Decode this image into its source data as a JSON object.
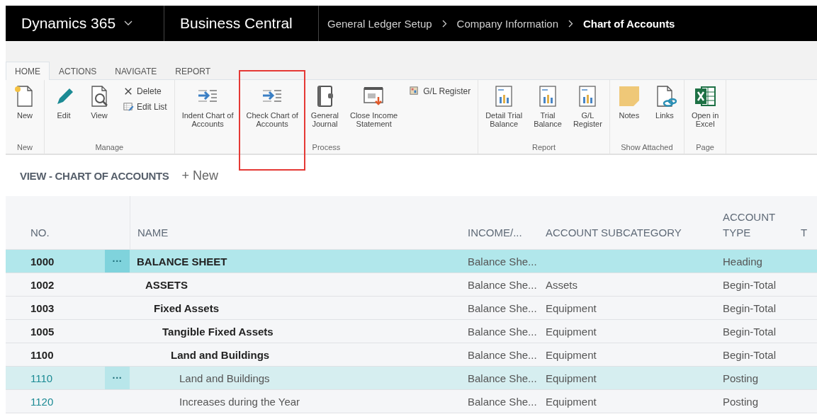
{
  "topbar": {
    "product": "Dynamics 365",
    "app": "Business Central",
    "breadcrumb": [
      {
        "label": "General Ledger Setup",
        "current": false
      },
      {
        "label": "Company Information",
        "current": false
      },
      {
        "label": "Chart of Accounts",
        "current": true
      }
    ]
  },
  "ribbon": {
    "tabs": [
      {
        "label": "HOME",
        "selected": true
      },
      {
        "label": "ACTIONS",
        "selected": false
      },
      {
        "label": "NAVIGATE",
        "selected": false
      },
      {
        "label": "REPORT",
        "selected": false
      }
    ],
    "groups": [
      {
        "label": "New",
        "items": [
          {
            "label": "New",
            "kind": "large",
            "highlighted": false
          }
        ]
      },
      {
        "label": "Manage",
        "items": [
          {
            "label": "Edit",
            "kind": "large",
            "highlighted": false
          },
          {
            "label": "View",
            "kind": "large",
            "highlighted": false
          },
          {
            "label": "Delete",
            "kind": "small"
          },
          {
            "label": "Edit List",
            "kind": "small"
          }
        ]
      },
      {
        "label": "Process",
        "items": [
          {
            "label": "Indent Chart of\nAccounts",
            "kind": "large",
            "highlighted": false
          },
          {
            "label": "Check Chart of\nAccounts",
            "kind": "large",
            "highlighted": true
          },
          {
            "label": "General\nJournal",
            "kind": "large",
            "highlighted": false
          },
          {
            "label": "Close Income\nStatement",
            "kind": "large",
            "highlighted": false
          },
          {
            "label": "G/L Register",
            "kind": "small"
          }
        ]
      },
      {
        "label": "Report",
        "items": [
          {
            "label": "Detail Trial\nBalance",
            "kind": "large",
            "highlighted": false
          },
          {
            "label": "Trial\nBalance",
            "kind": "large",
            "highlighted": false
          },
          {
            "label": "G/L\nRegister",
            "kind": "large",
            "highlighted": false
          }
        ]
      },
      {
        "label": "Show Attached",
        "items": [
          {
            "label": "Notes",
            "kind": "large",
            "highlighted": false
          },
          {
            "label": "Links",
            "kind": "large",
            "highlighted": false
          }
        ]
      },
      {
        "label": "Page",
        "items": [
          {
            "label": "Open in\nExcel",
            "kind": "large",
            "highlighted": false
          }
        ]
      }
    ]
  },
  "view": {
    "title": "VIEW - CHART OF ACCOUNTS",
    "new_action": "+ New"
  },
  "table": {
    "columns": [
      "NO.",
      "NAME",
      "INCOME/...",
      "ACCOUNT SUBCATEGORY",
      "ACCOUNT TYPE",
      "T"
    ],
    "rows": [
      {
        "no": "1000",
        "name": "BALANCE SHEET",
        "income": "Balance She...",
        "type": "Heading",
        "bold": true,
        "selected": true,
        "hovered": false,
        "menu": "···",
        "children": [
          {
            "no": "1002",
            "name": "ASSETS",
            "income": "Balance She...",
            "subcategory": "Assets",
            "type": "Begin-Total",
            "bold": true,
            "selected": false,
            "hovered": false,
            "children": [
              {
                "no": "1003",
                "name": "Fixed Assets",
                "income": "Balance She...",
                "subcategory": "Equipment",
                "type": "Begin-Total",
                "bold": true,
                "selected": false,
                "hovered": false,
                "children": [
                  {
                    "no": "1005",
                    "name": "Tangible Fixed Assets",
                    "income": "Balance She...",
                    "subcategory": "Equipment",
                    "type": "Begin-Total",
                    "bold": true,
                    "selected": false,
                    "hovered": false,
                    "children": [
                      {
                        "no": "1100",
                        "name": "Land and Buildings",
                        "income": "Balance She...",
                        "subcategory": "Equipment",
                        "type": "Begin-Total",
                        "bold": true,
                        "selected": false,
                        "hovered": false,
                        "children": [
                          {
                            "no": "1110",
                            "name": "Land and Buildings",
                            "income": "Balance She...",
                            "subcategory": "Equipment",
                            "type": "Posting",
                            "bold": false,
                            "selected": false,
                            "hovered": true,
                            "menu": "···"
                          },
                          {
                            "no": "1120",
                            "name": "Increases during the Year",
                            "income": "Balance She...",
                            "subcategory": "Equipment",
                            "type": "Posting",
                            "bold": false,
                            "selected": false,
                            "hovered": false
                          }
                        ]
                      }
                    ]
                  }
                ]
              }
            ]
          }
        ]
      }
    ]
  }
}
